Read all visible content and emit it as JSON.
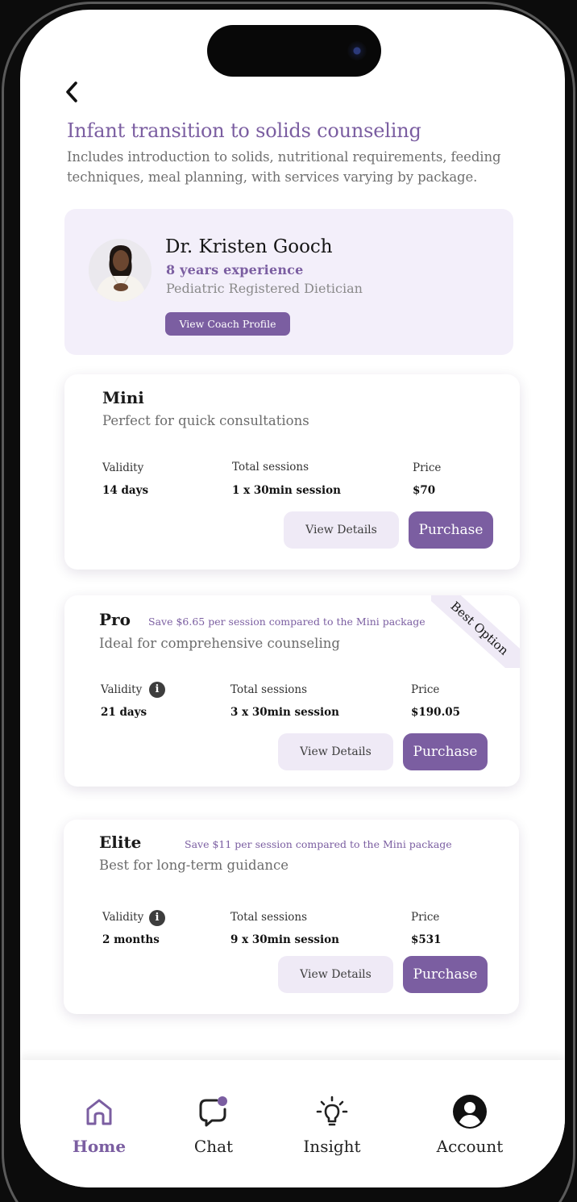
{
  "header": {
    "title": "Infant transition to solids counseling",
    "subtitle": "Includes introduction to solids, nutritional requirements, feeding techniques, meal planning, with services varying by package."
  },
  "coach": {
    "name": "Dr. Kristen Gooch",
    "experience": "8 years experience",
    "role": "Pediatric Registered Dietician",
    "profile_button": "View Coach Profile"
  },
  "packages": [
    {
      "name": "Mini",
      "savings": "",
      "description": "Perfect for quick consultations",
      "validity_label": "Validity",
      "validity": "14 days",
      "sessions_label": "Total sessions",
      "sessions": "1 x 30min session",
      "price_label": "Price",
      "price": "$70",
      "details_button": "View Details",
      "purchase_button": "Purchase"
    },
    {
      "name": "Pro",
      "savings": "Save $6.65 per session compared to the Mini package",
      "ribbon": "Best Option",
      "description": "Ideal for comprehensive counseling",
      "validity_label": "Validity",
      "validity": "21 days",
      "sessions_label": "Total sessions",
      "sessions": "3 x 30min session",
      "price_label": "Price",
      "price": "$190.05",
      "details_button": "View Details",
      "purchase_button": "Purchase"
    },
    {
      "name": "Elite",
      "savings": "Save $11 per session compared to the Mini package",
      "description": "Best for long-term guidance",
      "validity_label": "Validity",
      "validity": "2 months",
      "sessions_label": "Total sessions",
      "sessions": "9 x 30min session",
      "price_label": "Price",
      "price": "$531",
      "details_button": "View Details",
      "purchase_button": "Purchase"
    }
  ],
  "tabbar": {
    "items": [
      {
        "label": "Home",
        "icon": "home-icon",
        "active": true
      },
      {
        "label": "Chat",
        "icon": "chat-icon",
        "active": false
      },
      {
        "label": "Insight",
        "icon": "lightbulb-icon",
        "active": false
      },
      {
        "label": "Account",
        "icon": "account-icon",
        "active": false
      }
    ]
  },
  "colors": {
    "accent": "#7b5ea1",
    "accent_light": "#efeaf6",
    "coach_bg": "#f3effa"
  },
  "info_icon_glyph": "i"
}
